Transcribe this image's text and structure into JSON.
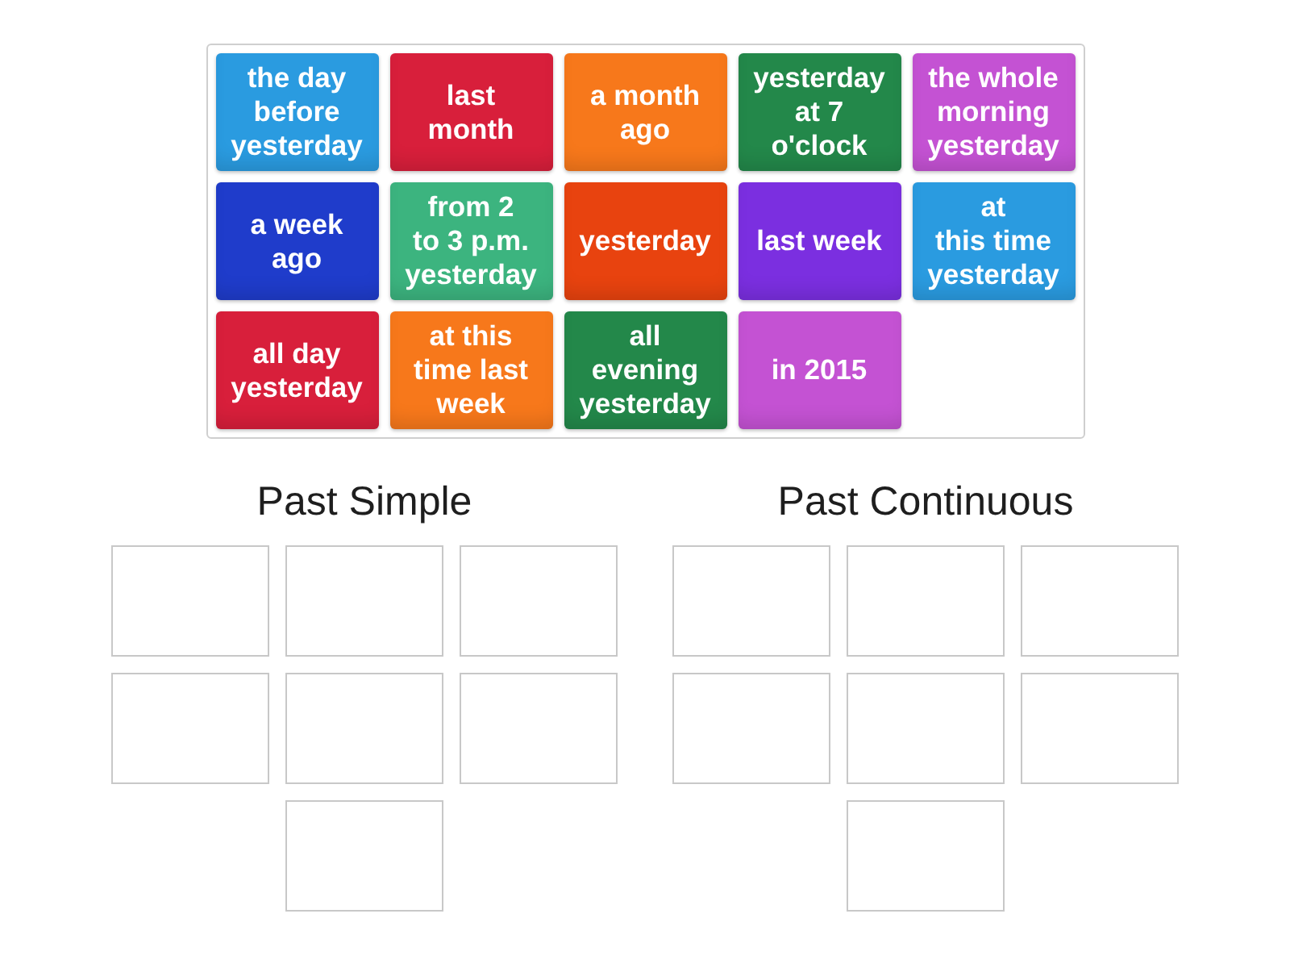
{
  "tiles": [
    {
      "text": "the day\nbefore\nyesterday",
      "color": "#2a9be0"
    },
    {
      "text": "last\nmonth",
      "color": "#d81f3b"
    },
    {
      "text": "a month\nago",
      "color": "#f7781b"
    },
    {
      "text": "yesterday\nat 7\no'clock",
      "color": "#23884a"
    },
    {
      "text": "the whole\nmorning\nyesterday",
      "color": "#c452d3"
    },
    {
      "text": "a week\nago",
      "color": "#1f3ccb"
    },
    {
      "text": "from 2\nto 3 p.m.\nyesterday",
      "color": "#3cb47f"
    },
    {
      "text": "yesterday",
      "color": "#e8430f"
    },
    {
      "text": "last week",
      "color": "#7b2fe0"
    },
    {
      "text": "at\nthis time\nyesterday",
      "color": "#2a9be0"
    },
    {
      "text": "all day\nyesterday",
      "color": "#d81f3b"
    },
    {
      "text": "at this\ntime last\nweek",
      "color": "#f7781b"
    },
    {
      "text": "all\nevening\nyesterday",
      "color": "#23884a"
    },
    {
      "text": "in 2015",
      "color": "#c452d3"
    }
  ],
  "groups": [
    {
      "title": "Past Simple"
    },
    {
      "title": "Past Continuous"
    }
  ]
}
